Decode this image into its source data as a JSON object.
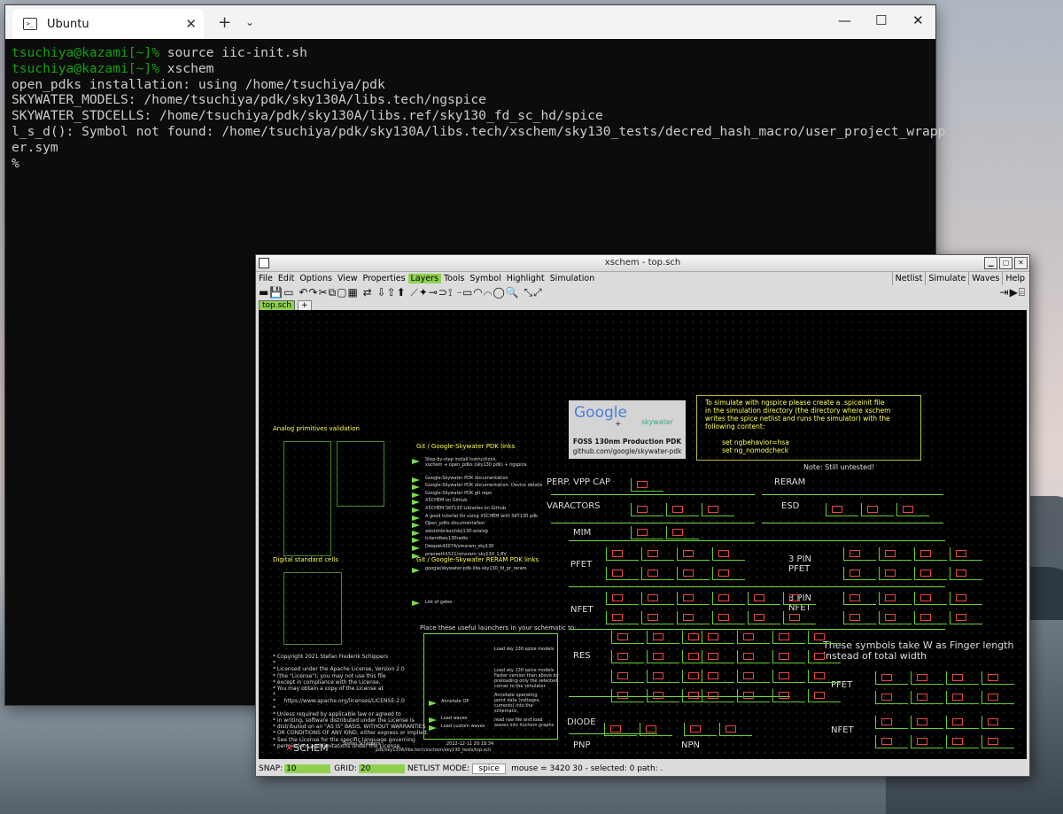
{
  "terminal": {
    "tab_title": "Ubuntu",
    "lines": [
      {
        "prompt": "tsuchiya@kazami[~]%",
        "cmd": " source iic-init.sh"
      },
      {
        "prompt": "tsuchiya@kazami[~]%",
        "cmd": " xschem"
      },
      {
        "prompt": "",
        "cmd": "open_pdks installation: using /home/tsuchiya/pdk"
      },
      {
        "prompt": "",
        "cmd": "SKYWATER_MODELS: /home/tsuchiya/pdk/sky130A/libs.tech/ngspice"
      },
      {
        "prompt": "",
        "cmd": "SKYWATER_STDCELLS: /home/tsuchiya/pdk/sky130A/libs.ref/sky130_fd_sc_hd/spice"
      },
      {
        "prompt": "",
        "cmd": "l_s_d(): Symbol not found: /home/tsuchiya/pdk/sky130A/libs.tech/xschem/sky130_tests/decred_hash_macro/user_project_wrapp"
      },
      {
        "prompt": "",
        "cmd": "er.sym"
      },
      {
        "prompt": "",
        "cmd": "%"
      }
    ]
  },
  "xschem": {
    "title": "xschem - top.sch",
    "menu": [
      "File",
      "Edit",
      "Options",
      "View",
      "Properties",
      "Layers",
      "Tools",
      "Symbol",
      "Highlight",
      "Simulation"
    ],
    "active_menu": "Layers",
    "right_menu": [
      "Netlist",
      "Simulate",
      "Waves",
      "Help"
    ],
    "toolbar_icons": "▬💾▭ ↶↷✂⧉▢▦ ⇄ ⇩⇧⬆ ⟋✦⊸⊃⟟ ⎯▭◠⌒◯🔍 ⤡⤢",
    "toolbar_right": "⇥▶⌸",
    "tab": "top.sch",
    "tab_add": "+",
    "status": {
      "snap_label": "SNAP:",
      "snap": "10",
      "grid_label": "GRID:",
      "grid": "20",
      "netlist_label": "NETLIST MODE:",
      "netlist": "spice",
      "mouse": "mouse = 3420 30 - selected: 0 path: ."
    }
  },
  "schematic": {
    "sim_note": "To simulate with ngspice please create a .spiceinit file\nin the simulation directory (the directory where xschem\nwrites the spice netlist and runs the simulator) with the\nfollowing content:\n\n        set ngbehavior=hsa\n        set ng_nomodcheck",
    "untested": "Note: Still untested!",
    "logo_caption1": "FOSS 130nm Production PDK",
    "logo_caption2": "github.com/google/skywater-pdk",
    "logo_google": "Google",
    "logo_plus": "+",
    "logo_sky": "skywater",
    "analog_title": "Analog primitives validation",
    "digital_title": "Digital standard cells",
    "git_title": "Git / Google-Skywater PDK links",
    "reram_title": "Git / Google-Skywater RERAM PDK links",
    "reram_link": "google/skywater-pdk-libs-sky130_fd_pr_reram",
    "gates_link": "List of gates",
    "links": [
      "Step-by-step install instructions,\nxschem + open_pdks (sky130 pdk) + ngspice",
      "Google-Skywater PDK documentation",
      "Google-Skywater PDK documentation: Device details",
      "Google-Skywater PDK git repo",
      "XSCHEM on Github",
      "XSCHEM SKY130 Libraries on Github",
      "A good tutorial for using XSCHEM with SKY130 pdk",
      "Open_pdks documentation",
      "westonbraun/sky130-analog",
      "tclamdkey130radio",
      "Deepak42074/xmsram_sky130",
      "praneeth1511/xmsram_sky130_1.8V"
    ],
    "launchers_title": "Place these useful launchers in your schematic to:",
    "launch1": "Load sky 130 spice models",
    "launch2": "Load sky 130 spice models\nFaster version than above by\npreloading only the selected\ncorner to the simulator.",
    "launch3": "Annotate operating\npoint data (voltages,\ncurrents) into the\nschematic.",
    "launch4": "read raw file and load\nwaves into Xschem graphs",
    "ann_off": "Annotate OP",
    "load_waves": "Load waves",
    "load_custom": "Load custom waves",
    "license": "* Copyright 2021 Stefan Frederik Schippers\n*\n* Licensed under the Apache License, Version 2.0\n* (the \"License\"); you may not use this file\n* except in compliance with the License.\n* You may obtain a copy of the License at\n*\n*     https://www.apache.org/licenses/LICENSE-2.0\n*\n* Unless required by applicable law or agreed to\n* in writing, software distributed under the License is\n* distributed on an \"AS IS\" BASIS, WITHOUT WARRANTIES\n* OR CONDITIONS OF ANY KIND, either express or implied.\n* See the License for the specific language governing\n* permissions and limitations under the License.",
    "xschem_logo": "SCHEM",
    "author": "Stefan Schippers",
    "date": "2022-12-11 20:18:34",
    "path": "pdk/sky130A/libs.tech/xschem/sky130_tests/top.sch",
    "labels": {
      "perp": "PERP. VPP CAP",
      "varactors": "VARACTORS",
      "mim": "MIM",
      "pfet": "PFET",
      "nfet": "NFET",
      "res": "RES",
      "diode": "DIODE",
      "pnp": "PNP",
      "npn": "NPN",
      "reram": "RERAM",
      "esd": "ESD",
      "pfet3": "3 PIN\nPFET",
      "nfet3": "3 PIN\nNFET",
      "finger": "These symbols take W as Finger length\ninstead of total width",
      "pfet_f": "PFET",
      "nfet_f": "NFET"
    }
  }
}
